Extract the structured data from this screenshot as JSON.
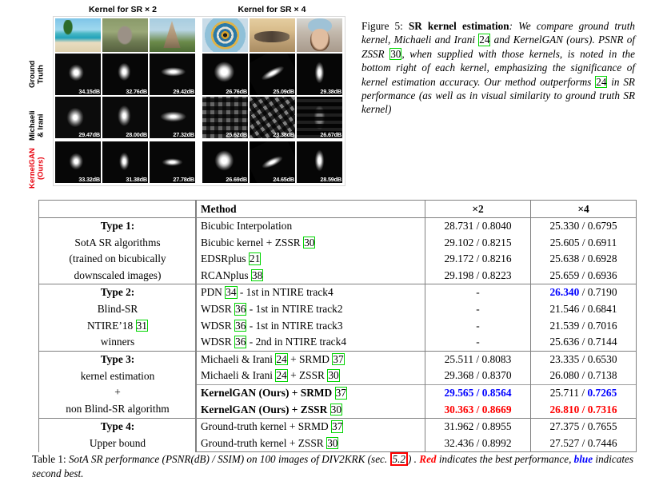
{
  "figure": {
    "column_titles": [
      "Kernel for SR × 2",
      "Kernel for SR × 4"
    ],
    "row_labels": [
      "Ground\nTruth",
      "Michaeli\n& Irani",
      "KernelGAN\n(Ours)"
    ],
    "row_label_colors": [
      "#000000",
      "#000000",
      "#e8000d"
    ],
    "psnr": {
      "ground_truth": [
        "34.15dB",
        "32.76dB",
        "29.42dB",
        "26.76dB",
        "25.09dB",
        "29.38dB"
      ],
      "michaeli_irani": [
        "29.47dB",
        "28.00dB",
        "27.32dB",
        "25.62dB",
        "23.38dB",
        "26.67dB"
      ],
      "kernelgan": [
        "33.32dB",
        "31.38dB",
        "27.78dB",
        "26.69dB",
        "24.65dB",
        "28.59dB"
      ]
    },
    "caption": {
      "label": "Figure 5:",
      "title": "SR kernel estimation",
      "text_1": ": We compare ground truth kernel, Michaeli and Irani ",
      "cite_24a": "24",
      "text_2": " and KernelGAN (ours).  PSNR of ZSSR ",
      "cite_30": "30",
      "text_3": ", when supplied with those kernels, is noted in the bottom right of each kernel, emphasizing the significance of kernel estimation accuracy.  Our method outperforms ",
      "cite_24b": "24",
      "text_4": " in SR performance (as well as in visual similarity to ground truth SR kernel)"
    }
  },
  "table": {
    "headers": [
      "",
      "Method",
      "×2",
      "×4"
    ],
    "groups": [
      {
        "type_label": "Type 1",
        "type_lines": [
          "Type 1:",
          "SotA SR algorithms",
          "(trained on bicubically",
          "downscaled images)"
        ],
        "rows": [
          {
            "method": "Bicubic Interpolation",
            "cite": "",
            "x2": "28.731 / 0.8040",
            "x4": "25.330 / 0.6795"
          },
          {
            "method": "Bicubic kernel + ZSSR ",
            "cite": "30",
            "x2": "29.102 / 0.8215",
            "x4": "25.605 / 0.6911"
          },
          {
            "method": "EDSRplus ",
            "cite": "21",
            "x2": "29.172 / 0.8216",
            "x4": "25.638 / 0.6928"
          },
          {
            "method": "RCANplus ",
            "cite": "38",
            "x2": "29.198 / 0.8223",
            "x4": "25.659 / 0.6936"
          }
        ]
      },
      {
        "type_label": "Type 2",
        "type_lines": [
          "Type 2:",
          "Blind-SR",
          "NTIRE'18 [31]",
          "winners"
        ],
        "type_cite": "31",
        "rows": [
          {
            "method_pre": "PDN ",
            "cite": "34",
            "method_post": " - 1st in NTIRE track4",
            "x2": "-",
            "x4_a": "26.340",
            "x4_a_color": "blue",
            "x4_b": " / 0.7190"
          },
          {
            "method_pre": "WDSR ",
            "cite": "36",
            "method_post": " - 1st in NTIRE track2",
            "x2": "-",
            "x4": "21.546 / 0.6841"
          },
          {
            "method_pre": "WDSR ",
            "cite": "36",
            "method_post": " - 1st in NTIRE track3",
            "x2": "-",
            "x4": "21.539 / 0.7016"
          },
          {
            "method_pre": "WDSR ",
            "cite": "36",
            "method_post": " - 2nd in NTIRE track4",
            "x2": "-",
            "x4": "25.636 / 0.7144"
          }
        ]
      },
      {
        "type_label": "Type 3",
        "type_lines": [
          "Type 3:",
          "kernel estimation",
          "+",
          "non Blind-SR algorithm"
        ],
        "rows": [
          {
            "method_pre": "Michaeli & Irani ",
            "cite": "24",
            "method_mid": " + SRMD ",
            "cite2": "37",
            "x2": "25.511 / 0.8083",
            "x4": "23.335 / 0.6530"
          },
          {
            "method_pre": "Michaeli & Irani ",
            "cite": "24",
            "method_mid": " + ZSSR ",
            "cite2": "30",
            "x2": "29.368 / 0.8370",
            "x4": "26.080 / 0.7138"
          },
          {
            "method_pre": "KernelGAN (Ours) + SRMD ",
            "cite2": "37",
            "bold": true,
            "x2_a": "29.565 / 0.8564",
            "x2_color": "blue",
            "x4_a": "25.711 / ",
            "x4_b": "0.7265",
            "x4_b_color": "blue"
          },
          {
            "method_pre": "KernelGAN (Ours) + ZSSR ",
            "cite2": "30",
            "bold": true,
            "x2_a": "30.363 / 0.8669",
            "x2_color": "red",
            "x4_a": "26.810 / 0.7316",
            "x4_color": "red"
          }
        ]
      },
      {
        "type_label": "Type 4",
        "type_lines": [
          "Type 4:",
          "Upper bound"
        ],
        "rows": [
          {
            "method_pre": "Ground-truth kernel + SRMD ",
            "cite2": "37",
            "x2": "31.962 / 0.8955",
            "x4": "27.375 / 0.7655"
          },
          {
            "method_pre": "Ground-truth kernel + ZSSR ",
            "cite2": "30",
            "x2": "32.436 / 0.8992",
            "x4": "27.527 / 0.7446"
          }
        ]
      }
    ],
    "caption": {
      "label": "Table 1:",
      "text_1": " SotA SR performance (PSNR(dB) / SSIM) on 100 images of DIV2KRK (sec. ",
      "sec_ref": "5.2",
      "text_2": ") . ",
      "red_word": "Red",
      "text_3": " indicates the best performance, ",
      "blue_word": "blue",
      "text_4": " indicates second best."
    }
  },
  "colors": {
    "red": "#ff0000",
    "blue": "#0000ff",
    "cite_box": "#00d500",
    "kernelgan_label": "#e8000d",
    "rule": "#808080"
  }
}
